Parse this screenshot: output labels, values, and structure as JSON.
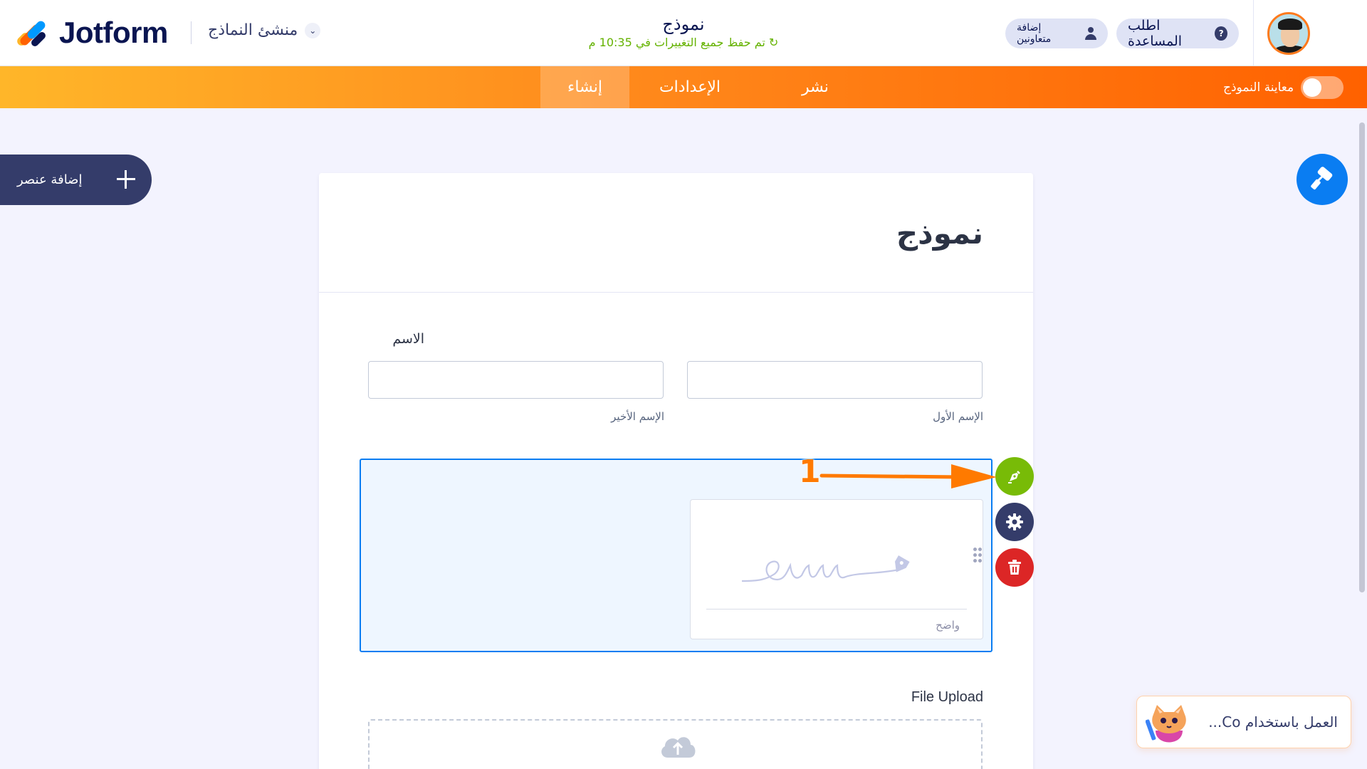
{
  "header": {
    "brand": "Jotform",
    "app_switcher": "منشئ النماذج",
    "form_title": "نموذج",
    "save_status": "تم حفظ جميع التغييرات في 10:35 م",
    "save_icon": "↻",
    "add_collaborators": "إضافة متعاونين",
    "get_help": "اطلب المساعدة",
    "help_icon": "?"
  },
  "nav": {
    "publish": "نشر",
    "settings": "الإعدادات",
    "build": "إنشاء",
    "preview_form": "معاينة النموذج",
    "preview_toggle_on": false
  },
  "sidebar": {
    "add_element": "إضافة عنصر"
  },
  "form": {
    "title": "نموذج",
    "name_field": {
      "label": "الاسم",
      "first_sublabel": "الإسم الأول",
      "last_sublabel": "الإسم الأخير",
      "first_value": "",
      "last_value": ""
    },
    "signature_field": {
      "clear_label": "واضح"
    },
    "file_upload": {
      "label": "File Upload"
    }
  },
  "annotation": {
    "step_number": "1"
  },
  "chat_widget": {
    "text": "العمل باستخدام Co..."
  },
  "colors": {
    "nav_gradient_start": "#ffb629",
    "nav_gradient_end": "#ff6100",
    "selection_blue": "#0a7df2",
    "edit_green": "#78bb07",
    "delete_red": "#dc2626",
    "annotation_orange": "#ff7a00"
  },
  "icons": {
    "edit": "pen-nib-icon",
    "settings": "gear-icon",
    "delete": "trash-icon",
    "designer": "paint-roller-icon",
    "upload": "cloud-upload-icon"
  }
}
